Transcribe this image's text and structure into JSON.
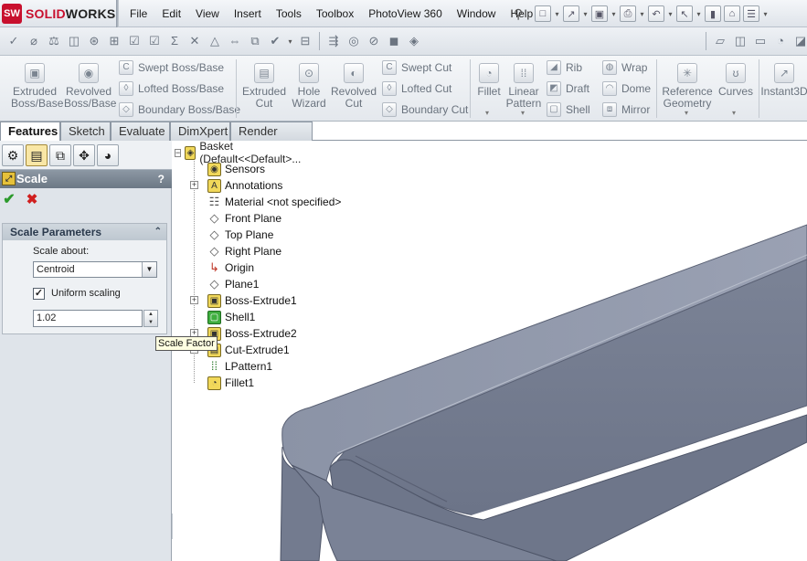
{
  "app": {
    "brand_prefix": "SOLID",
    "brand_suffix": "WORKS",
    "logo_text": "SW"
  },
  "menu": [
    "File",
    "Edit",
    "View",
    "Insert",
    "Tools",
    "Toolbox",
    "PhotoView 360",
    "Window",
    "Help"
  ],
  "command_manager": {
    "extruded_boss": "Extruded\nBoss/Base",
    "revolved_boss": "Revolved\nBoss/Base",
    "swept_boss": "Swept Boss/Base",
    "lofted_boss": "Lofted Boss/Base",
    "boundary_boss": "Boundary Boss/Base",
    "extruded_cut": "Extruded\nCut",
    "hole_wizard": "Hole\nWizard",
    "revolved_cut": "Revolved\nCut",
    "swept_cut": "Swept Cut",
    "lofted_cut": "Lofted Cut",
    "boundary_cut": "Boundary Cut",
    "fillet": "Fillet",
    "linear_pattern": "Linear\nPattern",
    "rib": "Rib",
    "draft": "Draft",
    "shell": "Shell",
    "wrap": "Wrap",
    "dome": "Dome",
    "mirror": "Mirror",
    "reference_geometry": "Reference\nGeometry",
    "curves": "Curves",
    "instant3d": "Instant3D"
  },
  "tabs": [
    "Features",
    "Sketch",
    "Evaluate",
    "DimXpert",
    "Render Tools"
  ],
  "property_manager": {
    "title": "Scale",
    "help": "?",
    "group_title": "Scale Parameters",
    "scale_about_label": "Scale about:",
    "scale_about_value": "Centroid",
    "uniform_scaling_label": "Uniform scaling",
    "uniform_scaling_checked": true,
    "scale_factor_value": "1.02"
  },
  "tooltip": "Scale Factor",
  "tree": {
    "root": "Basket  (Default<<Default>...",
    "items": [
      {
        "label": "Sensors",
        "icon": "sensor-icon"
      },
      {
        "label": "Annotations",
        "icon": "annotation-icon",
        "expandable": true
      },
      {
        "label": "Material <not specified>",
        "icon": "material-icon"
      },
      {
        "label": "Front Plane",
        "icon": "plane-icon"
      },
      {
        "label": "Top Plane",
        "icon": "plane-icon"
      },
      {
        "label": "Right Plane",
        "icon": "plane-icon"
      },
      {
        "label": "Origin",
        "icon": "origin-icon"
      },
      {
        "label": "Plane1",
        "icon": "plane-icon"
      },
      {
        "label": "Boss-Extrude1",
        "icon": "extrude-icon",
        "expandable": true
      },
      {
        "label": "Shell1",
        "icon": "shell-icon"
      },
      {
        "label": "Boss-Extrude2",
        "icon": "extrude-icon",
        "expandable": true
      },
      {
        "label": "Cut-Extrude1",
        "icon": "cut-icon",
        "expandable": true
      },
      {
        "label": "LPattern1",
        "icon": "pattern-icon"
      },
      {
        "label": "Fillet1",
        "icon": "fillet-icon"
      }
    ]
  }
}
